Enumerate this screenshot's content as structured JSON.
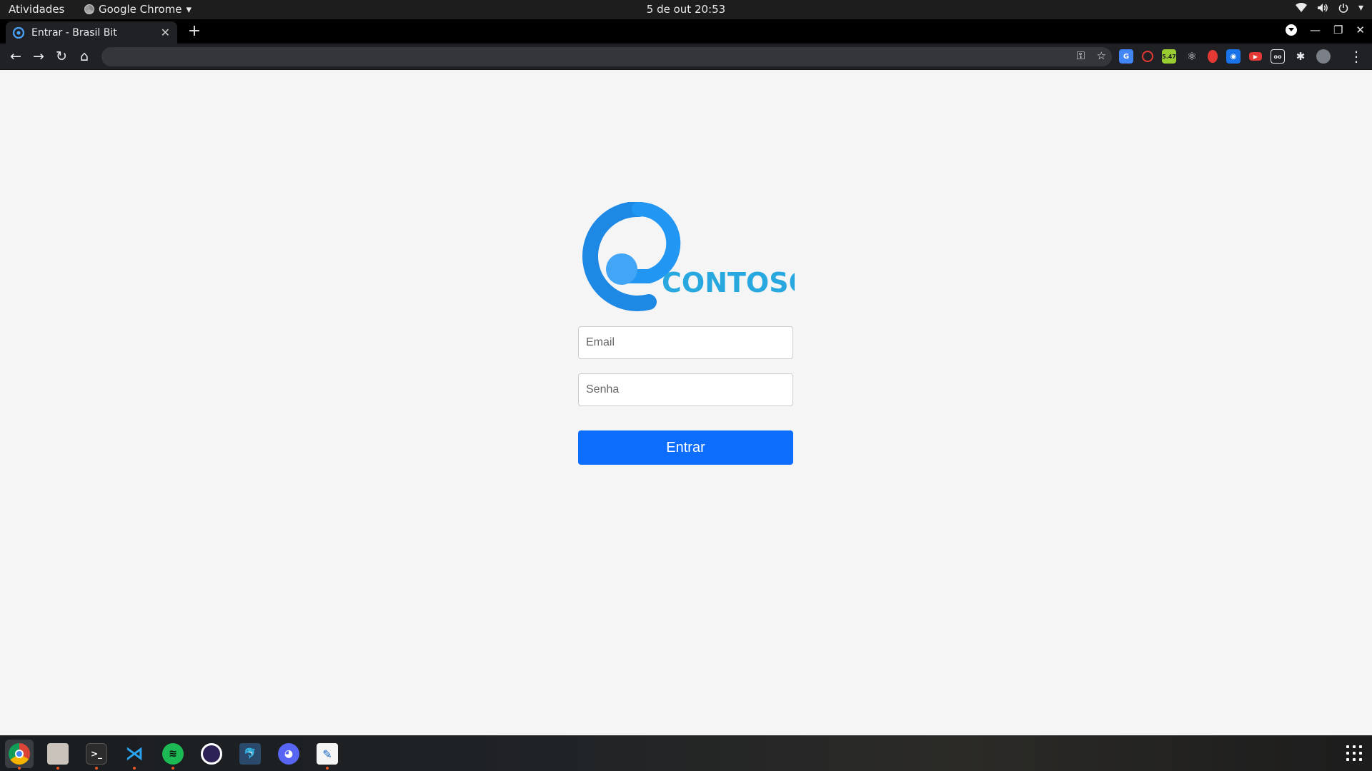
{
  "topbar": {
    "activities": "Atividades",
    "app_name": "Google Chrome",
    "clock": "5 de out  20:53"
  },
  "browser": {
    "tab_title": "Entrar - Brasil Bit",
    "address": ""
  },
  "login": {
    "logo_text": "CONTOSO",
    "email_placeholder": "Email",
    "password_placeholder": "Senha",
    "submit_label": "Entrar"
  },
  "extensions": {
    "badge_text": "5.47"
  },
  "colors": {
    "primary_button": "#0d6efd",
    "logo_blue": "#1e88e5",
    "logo_text": "#29a8e0",
    "page_bg": "#f5f5f5"
  },
  "dock": {
    "apps": [
      "chrome-icon",
      "files-icon",
      "terminal-icon",
      "vscode-icon",
      "spotify-icon",
      "eclipse-icon",
      "workbench-icon",
      "discord-icon",
      "text-editor-icon"
    ]
  }
}
